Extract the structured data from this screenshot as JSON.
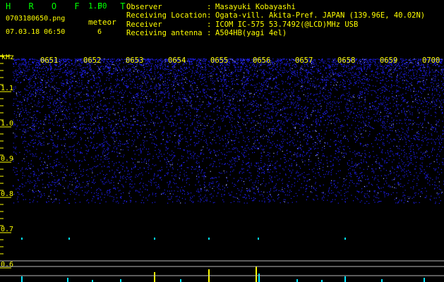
{
  "header": {
    "app_title": "H R O F F T",
    "version": "1.00",
    "file_name": "0703180650.png",
    "meteor_label": "meteor",
    "datetime": "07.03.18 06:50",
    "meteor_count": "6"
  },
  "info": [
    {
      "key": "Observer",
      "sep": ":",
      "value": "Masayuki Kobayashi"
    },
    {
      "key": "Receiving Location",
      "sep": ":",
      "value": "Ogata-vill. Akita-Pref. JAPAN (139.96E, 40.02N)"
    },
    {
      "key": "Receiver",
      "sep": ":",
      "value": "ICOM IC-575 53.7492(@LCD)MHz USB"
    },
    {
      "key": "Receiving antenna",
      "sep": ":",
      "value": "A504HB(yagi 4el)"
    }
  ],
  "plot": {
    "y_unit": "kHz",
    "y_ticks": [
      "1.1",
      "1.0",
      "0.9",
      "0.8",
      "0.7",
      "0.6"
    ],
    "time_labels": [
      "0651",
      "0652",
      "0653",
      "0654",
      "0655",
      "0656",
      "0657",
      "0658",
      "0659",
      "0700"
    ]
  },
  "colors": {
    "background": "#000000",
    "noise": "#1e1ef0",
    "text_green": "#00ff00",
    "text_yellow": "#ffff00",
    "signal_cyan": "#00e5ff",
    "signal_yellow": "#ffff00"
  }
}
